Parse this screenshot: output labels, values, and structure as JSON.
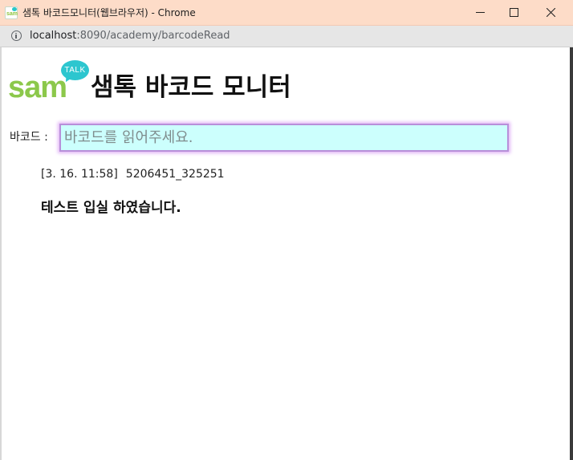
{
  "window": {
    "title": "샘톡 바코드모니터(웹브라우저) - Chrome"
  },
  "addressbar": {
    "host": "localhost",
    "path": ":8090/academy/barcodeRead"
  },
  "logo": {
    "text": "sam",
    "bubble_text": "TALK"
  },
  "page": {
    "title": "샘톡 바코드 모니터"
  },
  "barcode": {
    "label": "바코드 :",
    "placeholder": "바코드를 읽어주세요.",
    "value": ""
  },
  "scan": {
    "time": "[3. 16. 11:58]",
    "code": "5206451_325251",
    "message": "테스트 입실 하였습니다."
  },
  "colors": {
    "titlebar": "#fddcc8",
    "input_bg": "#ccfffd",
    "input_border": "#b88fd9",
    "logo_green": "#8cc84b",
    "logo_teal": "#2dc6cf"
  },
  "icons": {
    "info": "info-icon",
    "minimize": "minimize-icon",
    "maximize": "maximize-icon",
    "close": "close-icon"
  }
}
